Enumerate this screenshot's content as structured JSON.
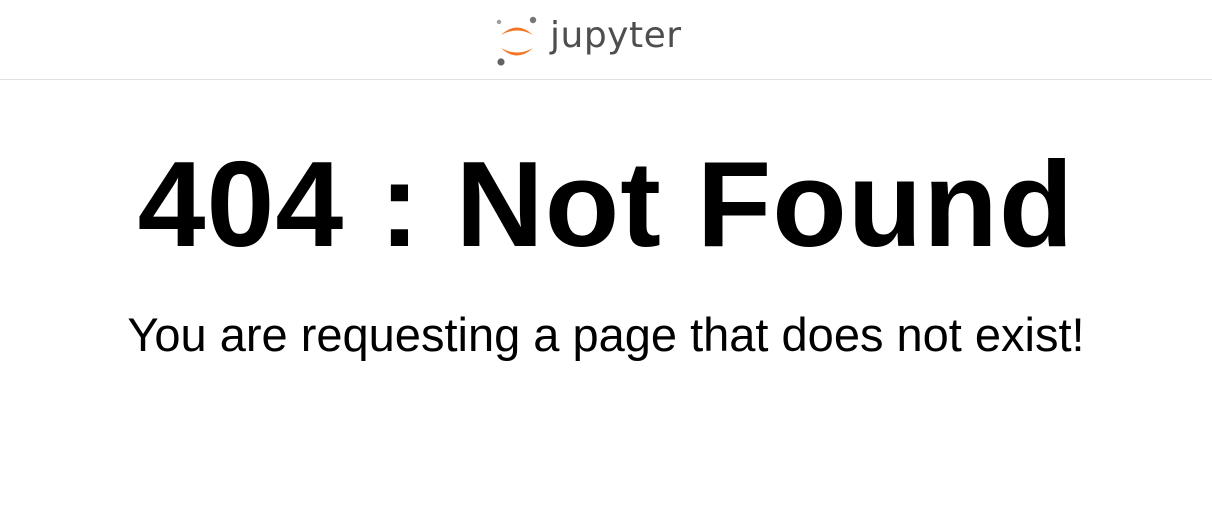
{
  "header": {
    "logo_text": "jupyter",
    "logo_icon": "jupyter-logo-icon",
    "colors": {
      "accent": "#f37726",
      "dots": "#9e9e9e",
      "wordmark": "#4e4e4e"
    }
  },
  "error": {
    "title": "404 : Not Found",
    "message": "You are requesting a page that does not exist!"
  }
}
